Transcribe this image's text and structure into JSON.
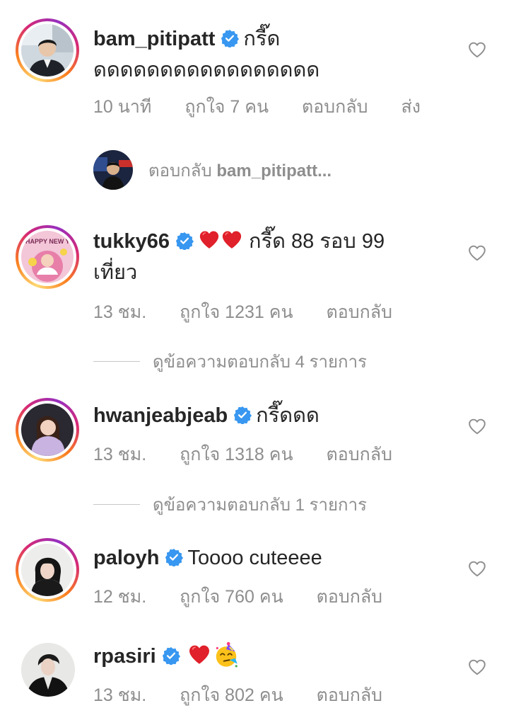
{
  "comments": [
    {
      "username": "bam_pitipatt",
      "text": "กรี๊ดดดดดดดดดดดดดดดดดด",
      "text_line1": "กรี๊ด",
      "text_line2": "ดดดดดดดดดดดดดดดดด",
      "time": "10 นาที",
      "likes": "ถูกใจ 7 คน",
      "reply": "ตอบกลับ",
      "send": "ส่ง"
    },
    {
      "username": "tukky66",
      "text_line1": "กรี๊ด 88 รอบ 99",
      "text_line2": "เที่ยว",
      "time": "13 ชม.",
      "likes": "ถูกใจ 1231 คน",
      "reply": "ตอบกลับ",
      "view_replies": "ดูข้อความตอบกลับ 4 รายการ"
    },
    {
      "username": "hwanjeabjeab",
      "text": "กรี๊ดดด",
      "time": "13 ชม.",
      "likes": "ถูกใจ 1318 คน",
      "reply": "ตอบกลับ",
      "view_replies": "ดูข้อความตอบกลับ 1 รายการ"
    },
    {
      "username": "paloyh",
      "text": "Toooo cuteeee",
      "time": "12 ชม.",
      "likes": "ถูกใจ 760 คน",
      "reply": "ตอบกลับ"
    },
    {
      "username": "rpasiri",
      "time": "13 ชม.",
      "likes": "ถูกใจ 802 คน",
      "reply": "ตอบกลับ"
    }
  ],
  "reply_prompt": {
    "prefix": "ตอบกลับ",
    "username": "bam_pitipatt..."
  },
  "colors": {
    "verified": "#3897f0",
    "meta_text": "#8e8e8e",
    "heart_emoji": "#e0202a"
  },
  "icons": [
    "verified-badge-icon",
    "heart-outline-icon",
    "red-heart-emoji",
    "party-face-emoji"
  ]
}
